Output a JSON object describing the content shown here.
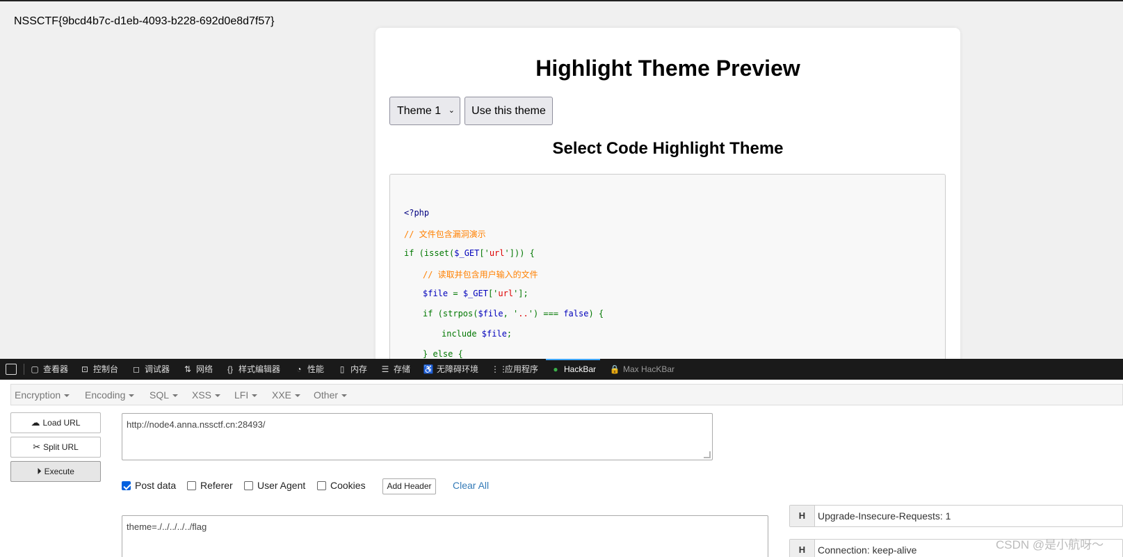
{
  "page": {
    "flag": "NSSCTF{9bcd4b7c-d1eb-4093-b228-692d0e8d7f57}",
    "title": "Highlight Theme Preview",
    "theme_select": "Theme 1",
    "use_theme_label": "Use this theme",
    "subtitle": "Select Code Highlight Theme",
    "code": {
      "l1": "<?php",
      "l2": "// 文件包含漏洞演示",
      "l3_kw": "if (isset(",
      "l3_var": "$_GET",
      "l3_b1": "['",
      "l3_str": "url",
      "l3_b2": "'])) {",
      "l4": "// 读取并包含用户输入的文件",
      "l5_var1": "$file",
      "l5_kw1": " = ",
      "l5_var2": "$_GET",
      "l5_b1": "['",
      "l5_str": "url",
      "l5_b2": "'];",
      "l6_kw1": "if (strpos(",
      "l6_var": "$file",
      "l6_kw2": ", '",
      "l6_str": "..",
      "l6_kw3": "') === ",
      "l6_false": "false",
      "l6_kw4": ") {",
      "l7_kw": "include ",
      "l7_var": "$file",
      "l7_end": ";",
      "l8": "} else {"
    }
  },
  "devtools": {
    "tabs": [
      {
        "label": "查看器",
        "icon": "▢"
      },
      {
        "label": "控制台",
        "icon": "⊡"
      },
      {
        "label": "调试器",
        "icon": "◻"
      },
      {
        "label": "网络",
        "icon": "⇅"
      },
      {
        "label": "样式编辑器",
        "icon": "{}"
      },
      {
        "label": "性能",
        "icon": "◔"
      },
      {
        "label": "内存",
        "icon": "▯"
      },
      {
        "label": "存储",
        "icon": "☰"
      },
      {
        "label": "无障碍环境",
        "icon": "♿"
      },
      {
        "label": "应用程序",
        "icon": "⋮⋮"
      },
      {
        "label": "HackBar",
        "icon": "●"
      },
      {
        "label": "Max HacKBar",
        "icon": "🔒"
      }
    ],
    "active_tab": "HackBar"
  },
  "hackbar": {
    "menu": [
      "Encryption",
      "Encoding",
      "SQL",
      "XSS",
      "LFI",
      "XXE",
      "Other"
    ],
    "load_url": "Load URL",
    "split_url": "Split URL",
    "execute": "Execute",
    "url": "http://node4.anna.nssctf.cn:28493/",
    "post_data_label": "Post data",
    "referer_label": "Referer",
    "user_agent_label": "User Agent",
    "cookies_label": "Cookies",
    "add_header": "Add Header",
    "clear_all": "Clear All",
    "post_body": "theme=./../../../../flag",
    "headers": [
      {
        "badge": "H",
        "value": "Upgrade-Insecure-Requests: 1"
      },
      {
        "badge": "H",
        "value": "Connection: keep-alive"
      }
    ]
  },
  "watermark": "CSDN @是小航呀～",
  "colors": {
    "devtools_bar": "#1a1a1a",
    "active_tab_accent": "#3fa7ff",
    "checkbox_accent": "#0060df",
    "link": "#337ab7"
  }
}
